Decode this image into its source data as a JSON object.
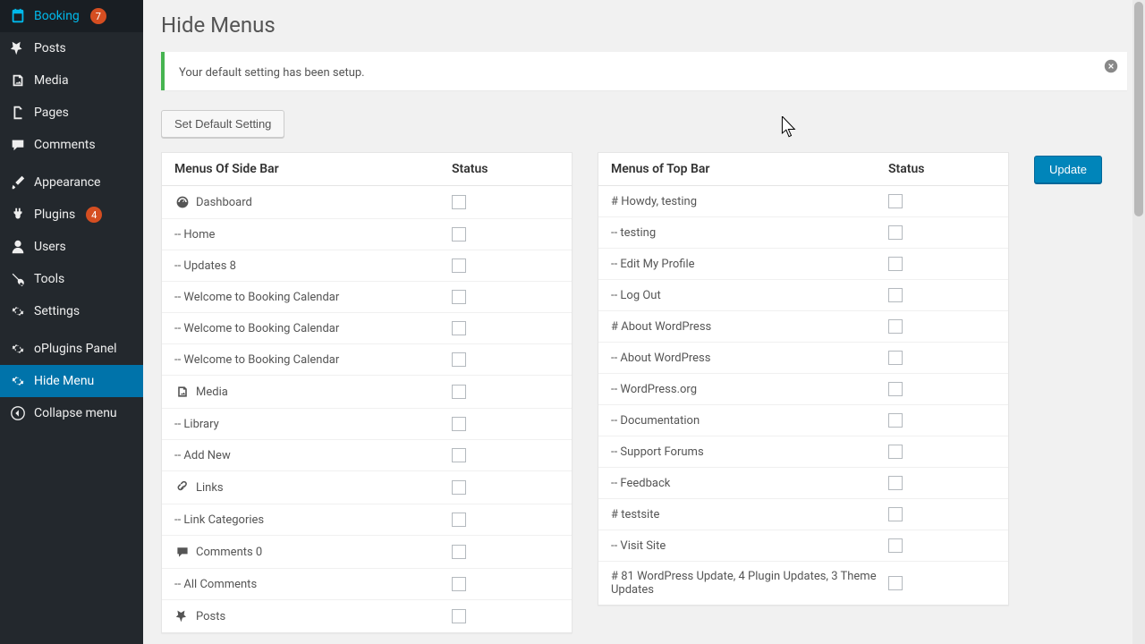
{
  "sidebar": {
    "items": [
      {
        "label": "Booking",
        "icon": "calendar",
        "badge": "7"
      },
      {
        "label": "Posts",
        "icon": "pin"
      },
      {
        "label": "Media",
        "icon": "media"
      },
      {
        "label": "Pages",
        "icon": "page"
      },
      {
        "label": "Comments",
        "icon": "comment"
      },
      {
        "label": "Appearance",
        "icon": "brush",
        "sep": true
      },
      {
        "label": "Plugins",
        "icon": "plugin",
        "badge": "4"
      },
      {
        "label": "Users",
        "icon": "user"
      },
      {
        "label": "Tools",
        "icon": "wrench"
      },
      {
        "label": "Settings",
        "icon": "gear"
      },
      {
        "label": "oPlugins Panel",
        "icon": "gear",
        "sep": true
      },
      {
        "label": "Hide Menu",
        "icon": "gear",
        "active": true
      },
      {
        "label": "Collapse menu",
        "icon": "collapse"
      }
    ]
  },
  "page": {
    "title": "Hide Menus",
    "notice": "Your default setting has been setup.",
    "default_btn": "Set Default Setting",
    "update_btn": "Update"
  },
  "left_table": {
    "header_label": "Menus Of Side Bar",
    "header_status": "Status",
    "rows": [
      {
        "label": "Dashboard",
        "icon": "dashboard"
      },
      {
        "label": "-- Home"
      },
      {
        "label": "-- Updates 8"
      },
      {
        "label": "-- Welcome to Booking Calendar"
      },
      {
        "label": "-- Welcome to Booking Calendar"
      },
      {
        "label": "-- Welcome to Booking Calendar"
      },
      {
        "label": "Media",
        "icon": "media"
      },
      {
        "label": "-- Library"
      },
      {
        "label": "-- Add New"
      },
      {
        "label": "Links",
        "icon": "link"
      },
      {
        "label": "-- Link Categories"
      },
      {
        "label": "Comments 0",
        "icon": "comment"
      },
      {
        "label": "-- All Comments"
      },
      {
        "label": "Posts",
        "icon": "pin"
      }
    ]
  },
  "right_table": {
    "header_label": "Menus of Top Bar",
    "header_status": "Status",
    "rows": [
      {
        "label": "# Howdy, testing"
      },
      {
        "label": "-- testing"
      },
      {
        "label": "-- Edit My Profile"
      },
      {
        "label": "-- Log Out"
      },
      {
        "label": "# About WordPress"
      },
      {
        "label": "-- About WordPress"
      },
      {
        "label": "-- WordPress.org"
      },
      {
        "label": "-- Documentation"
      },
      {
        "label": "-- Support Forums"
      },
      {
        "label": "-- Feedback"
      },
      {
        "label": "# testsite"
      },
      {
        "label": "-- Visit Site"
      },
      {
        "label": "# 81 WordPress Update, 4 Plugin Updates, 3 Theme Updates"
      }
    ]
  }
}
